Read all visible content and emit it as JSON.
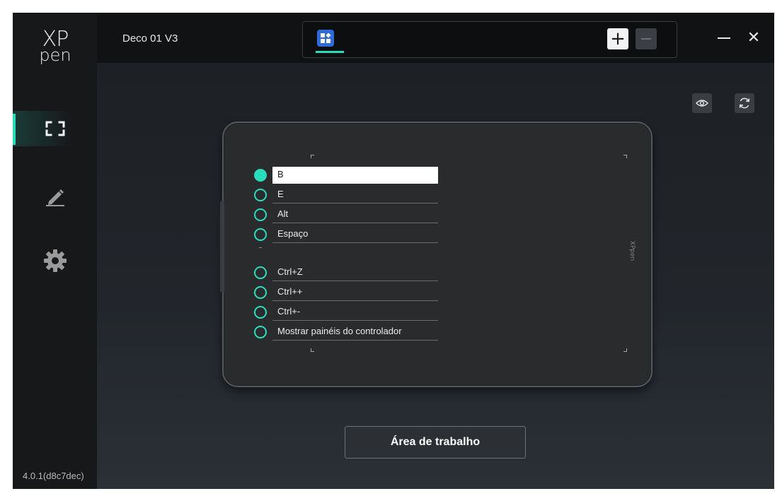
{
  "sidebar": {
    "logo_top": "XP",
    "logo_bottom": "pen",
    "items": [
      {
        "name": "work-area",
        "icon": "area-frame-icon",
        "active": true
      },
      {
        "name": "pen",
        "icon": "pen-icon",
        "active": false
      },
      {
        "name": "settings",
        "icon": "gear-icon",
        "active": false
      }
    ],
    "version": "4.0.1(d8c7dec)"
  },
  "header": {
    "device_name": "Deco 01 V3",
    "app_icon": "all-apps-icon",
    "add_label": "+",
    "close_label": "✕"
  },
  "toolbar": {
    "preview_icon": "eye-icon",
    "refresh_icon": "refresh-icon"
  },
  "tablet": {
    "brand": "XPpen",
    "keys_upper": [
      {
        "label": "B",
        "selected": true
      },
      {
        "label": "E",
        "selected": false
      },
      {
        "label": "Alt",
        "selected": false
      },
      {
        "label": "Espaço",
        "selected": false
      }
    ],
    "separator": "-",
    "keys_lower": [
      {
        "label": "Ctrl+Z",
        "selected": false
      },
      {
        "label": "Ctrl++",
        "selected": false
      },
      {
        "label": "Ctrl+-",
        "selected": false
      },
      {
        "label": "Mostrar painéis do controlador",
        "selected": false
      }
    ]
  },
  "main": {
    "workspace_button": "Área de trabalho"
  },
  "colors": {
    "accent": "#28deba",
    "background": "#1b1d20",
    "app_icon_blue": "#2f6bd9"
  }
}
